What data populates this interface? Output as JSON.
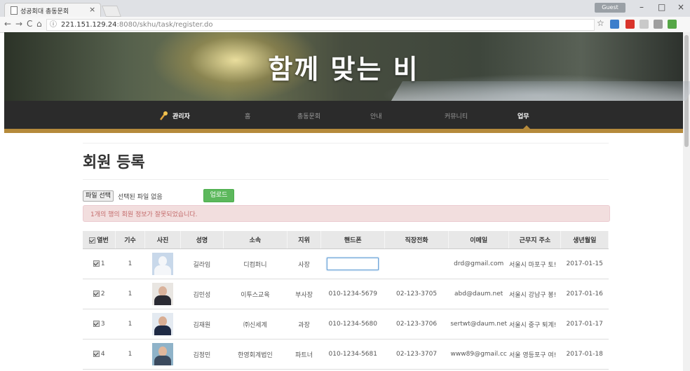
{
  "browser": {
    "tab_title": "성공회대 총동문회",
    "tab_close": "×",
    "url_host": "221.151.129.24",
    "url_rest": ":8080/skhu/task/register.do",
    "user_button": "Guest",
    "minimize": "–",
    "maximize": "□",
    "close": "×",
    "back": "←",
    "forward": "→",
    "reload": "C",
    "home": "⌂",
    "info": "ⓘ",
    "star": "☆"
  },
  "banner": {
    "title": "함께 맞는 비"
  },
  "nav": {
    "items": [
      {
        "label": "관리자"
      },
      {
        "label": "홈"
      },
      {
        "label": "총동문회"
      },
      {
        "label": "안내"
      },
      {
        "label": "커뮤니티"
      },
      {
        "label": "업무"
      }
    ],
    "active_color": "#b58a3b"
  },
  "page": {
    "title": "회원 등록",
    "file_button": "파일 선택",
    "file_status": "선택된 파일 없음",
    "upload_button": "업로드",
    "alert": "1개의 행의 회원 정보가 잘못되었습니다."
  },
  "table": {
    "headers": [
      "열번",
      "기수",
      "사진",
      "성명",
      "소속",
      "지위",
      "핸드폰",
      "직장전화",
      "이메일",
      "근무지 주소",
      "생년월일"
    ],
    "rows": [
      {
        "no": "1",
        "gen": "1",
        "name": "길라임",
        "org": "디컴퍼니",
        "pos": "사장",
        "phone": "",
        "work": "",
        "email": "drd@gmail.com",
        "addr": "서울시 마포구 토!",
        "birth": "2017-01-15",
        "photo": "placeholder"
      },
      {
        "no": "2",
        "gen": "1",
        "name": "김민성",
        "org": "이투스교육",
        "pos": "부사장",
        "phone": "010-1234-5679",
        "work": "02-123-3705",
        "email": "abd@daum.net",
        "addr": "서울시 강남구 봉!",
        "birth": "2017-01-16",
        "photo": "person"
      },
      {
        "no": "3",
        "gen": "1",
        "name": "김재원",
        "org": "㈜신세계",
        "pos": "과장",
        "phone": "010-1234-5680",
        "work": "02-123-3706",
        "email": "sertwt@daum.net",
        "addr": "서울시 중구 퇴계!",
        "birth": "2017-01-17",
        "photo": "person"
      },
      {
        "no": "4",
        "gen": "1",
        "name": "김정민",
        "org": "한영회계법인",
        "pos": "파트너",
        "phone": "010-1234-5681",
        "work": "02-123-3707",
        "email": "www89@gmail.cc",
        "addr": "서울 영등포구 여!",
        "birth": "2017-01-18",
        "photo": "person"
      }
    ]
  }
}
